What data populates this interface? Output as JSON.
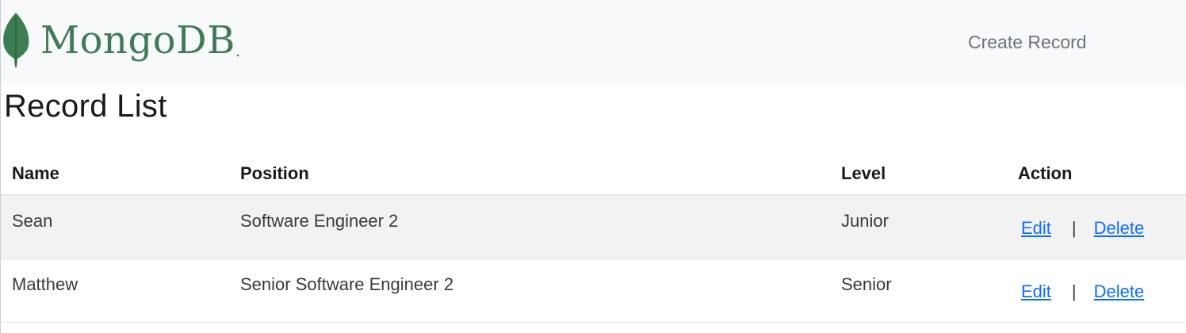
{
  "navbar": {
    "brand": {
      "name": "MongoDB",
      "trademark": ".",
      "logo_icon": "leaf-icon",
      "logo_color": "#3f7b57",
      "leaf_color": "#3d7d52"
    },
    "create_link_label": "Create Record"
  },
  "page_title": "Record List",
  "table": {
    "columns": [
      "Name",
      "Position",
      "Level",
      "Action"
    ],
    "rows": [
      {
        "name": "Sean",
        "position": "Software Engineer 2",
        "level": "Junior",
        "edit_label": "Edit",
        "separator": "|",
        "delete_label": "Delete"
      },
      {
        "name": "Matthew",
        "position": "Senior Software Engineer 2",
        "level": "Senior",
        "edit_label": "Edit",
        "separator": "|",
        "delete_label": "Delete"
      }
    ]
  },
  "colors": {
    "navbar_bg": "#f8f9fa",
    "link": "#0d6efd",
    "striped_row": "#f2f2f2"
  }
}
